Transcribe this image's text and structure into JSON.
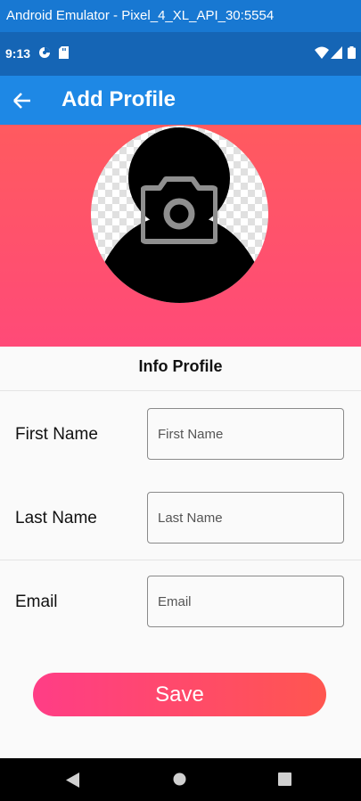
{
  "window": {
    "title": "Android Emulator - Pixel_4_XL_API_30:5554"
  },
  "status_bar": {
    "time": "9:13"
  },
  "app_bar": {
    "title": "Add Profile"
  },
  "header": {
    "avatar_icon": "person-silhouette-icon",
    "camera_icon": "camera-icon"
  },
  "section": {
    "title": "Info Profile"
  },
  "form": {
    "first_name": {
      "label": "First Name",
      "placeholder": "First Name",
      "value": ""
    },
    "last_name": {
      "label": "Last Name",
      "placeholder": "Last Name",
      "value": ""
    },
    "email": {
      "label": "Email",
      "placeholder": "Email",
      "value": ""
    }
  },
  "save_button": {
    "label": "Save"
  },
  "colors": {
    "title_bar": "#1878d2",
    "status_bar": "#1565b5",
    "app_bar": "#1e88e5",
    "header_gradient": [
      "#ff5a5f",
      "#ff4a78"
    ],
    "save_gradient": [
      "#ff3d86",
      "#ff5650"
    ]
  }
}
